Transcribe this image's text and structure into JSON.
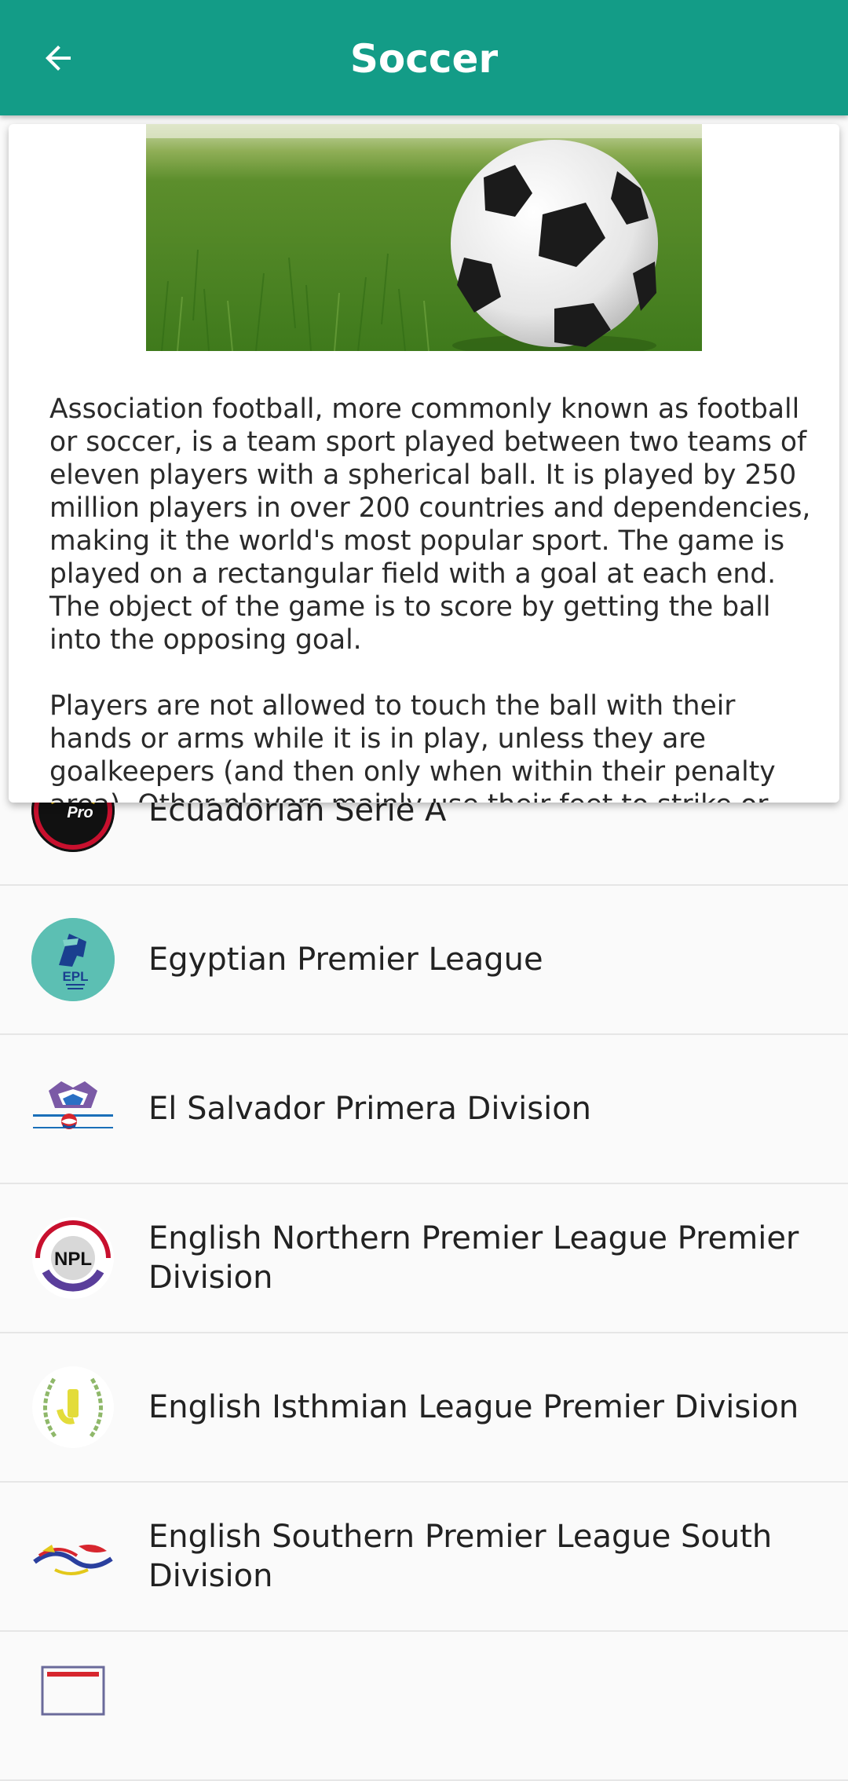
{
  "appbar": {
    "title": "Soccer",
    "back_icon": "arrow-left-icon",
    "background_color": "#139c87"
  },
  "card": {
    "image_icon": "soccer-ball-on-grass-image",
    "paragraphs": [
      "Association football, more commonly known as football or soccer, is a team sport played between two teams of eleven players with a spherical ball. It is played by 250 million players in over 200 countries and dependencies, making it the world's most popular sport. The game is played on a rectangular field with a goal at each end. The object of the game is to score by getting the ball into the opposing goal.",
      "Players are not allowed to touch the ball with their hands or arms while it is in play, unless they are goalkeepers (and then only when within their penalty area). Other players mainly use their feet to strike or pass the ball, but"
    ]
  },
  "leagues": [
    {
      "name": "Ecuadorian Serie A",
      "logo_icon": "ecuadorian-liga-pro-logo"
    },
    {
      "name": "Egyptian Premier League",
      "logo_icon": "egyptian-premier-league-logo"
    },
    {
      "name": "El Salvador Primera Division",
      "logo_icon": "el-salvador-primera-logo"
    },
    {
      "name": "English Northern Premier League Premier Division",
      "logo_icon": "npl-logo"
    },
    {
      "name": "English Isthmian League Premier Division",
      "logo_icon": "isthmian-league-logo"
    },
    {
      "name": "English Southern Premier League South Division",
      "logo_icon": "southern-league-logo"
    },
    {
      "name": "",
      "logo_icon": "partial-next-logo"
    }
  ]
}
